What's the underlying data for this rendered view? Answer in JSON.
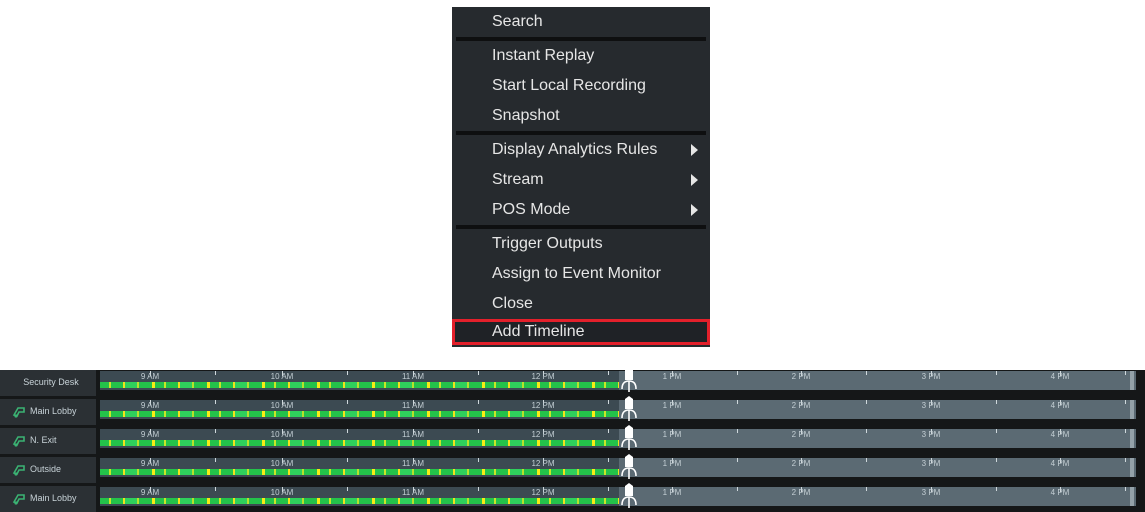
{
  "context_menu": {
    "groups": [
      [
        {
          "label": "Search",
          "submenu": false
        }
      ],
      [
        {
          "label": "Instant Replay",
          "submenu": false
        },
        {
          "label": "Start Local Recording",
          "submenu": false
        },
        {
          "label": "Snapshot",
          "submenu": false
        }
      ],
      [
        {
          "label": "Display Analytics Rules",
          "submenu": true
        },
        {
          "label": "Stream",
          "submenu": true
        },
        {
          "label": "POS Mode",
          "submenu": true
        }
      ],
      [
        {
          "label": "Trigger Outputs",
          "submenu": false
        },
        {
          "label": "Assign to Event Monitor",
          "submenu": false
        },
        {
          "label": "Close",
          "submenu": false
        },
        {
          "label": "Add Timeline",
          "submenu": false,
          "highlighted": true
        }
      ]
    ]
  },
  "timeline": {
    "hours": [
      "9 AM",
      "10 AM",
      "11 AM",
      "12 PM",
      "1 PM",
      "2 PM",
      "3 PM",
      "4 PM"
    ],
    "rows": [
      {
        "label": "Security Desk",
        "icon": "camera-analytics-icon",
        "show_icon": false
      },
      {
        "label": "Main Lobby",
        "icon": "camera-analytics-icon",
        "show_icon": true
      },
      {
        "label": "N. Exit",
        "icon": "camera-analytics-icon",
        "show_icon": true
      },
      {
        "label": "Outside",
        "icon": "camera-analytics-icon",
        "show_icon": true
      },
      {
        "label": "Main Lobby",
        "icon": "camera-analytics-icon",
        "show_icon": true
      }
    ]
  },
  "colors": {
    "menu_bg": "#262a2e",
    "highlight_outline": "#e3202b",
    "recording_green": "#24c24a",
    "recording_yellow": "#f2e21c",
    "icon_green": "#3bb273"
  }
}
